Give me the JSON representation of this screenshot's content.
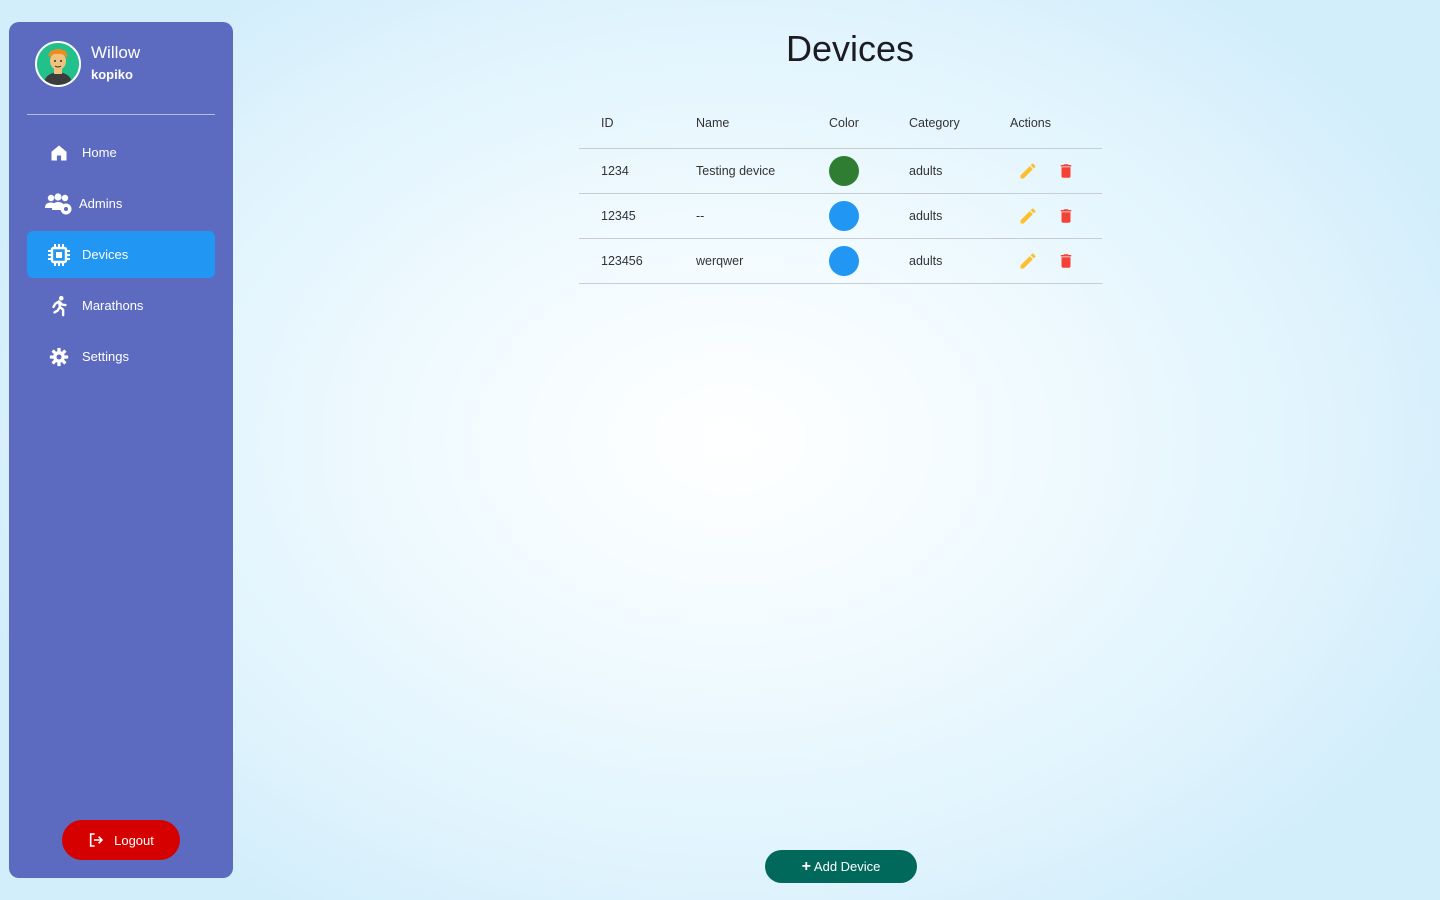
{
  "user": {
    "name": "Willow",
    "username": "kopiko"
  },
  "nav": {
    "items": [
      {
        "label": "Home",
        "icon": "home-icon"
      },
      {
        "label": "Admins",
        "icon": "admins-icon"
      },
      {
        "label": "Devices",
        "icon": "chip-icon",
        "active": true
      },
      {
        "label": "Marathons",
        "icon": "runner-icon"
      },
      {
        "label": "Settings",
        "icon": "gear-icon"
      }
    ],
    "logout_label": "Logout"
  },
  "page": {
    "title": "Devices",
    "add_button_label": "Add Device"
  },
  "table": {
    "headers": {
      "id": "ID",
      "name": "Name",
      "color": "Color",
      "category": "Category",
      "actions": "Actions"
    },
    "rows": [
      {
        "id": "1234",
        "name": "Testing device",
        "color": "#2e7d32",
        "category": "adults"
      },
      {
        "id": "12345",
        "name": "--",
        "color": "#2196f3",
        "category": "adults"
      },
      {
        "id": "123456",
        "name": "werqwer",
        "color": "#2196f3",
        "category": "adults"
      }
    ]
  },
  "colors": {
    "sidebar": "#5c6bc0",
    "active_nav": "#2196f3",
    "logout": "#d50000",
    "add_button": "#00695c",
    "edit_icon": "#fbc02d",
    "delete_icon": "#f44336"
  }
}
